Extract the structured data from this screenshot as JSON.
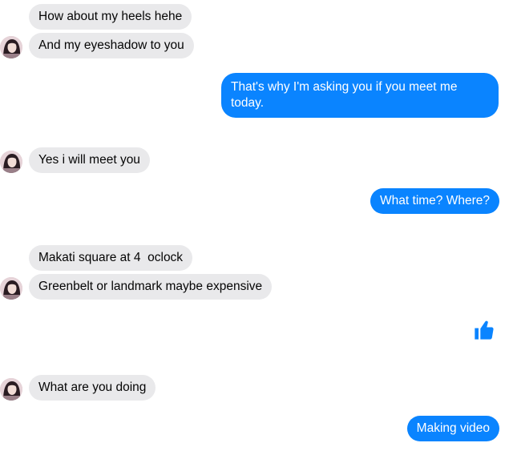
{
  "messages": [
    {
      "direction": "incoming",
      "text": "How about my heels hehe"
    },
    {
      "direction": "incoming",
      "text": "And my eyeshadow to you"
    },
    {
      "direction": "outgoing",
      "text": "That's why I'm asking you if you meet me today."
    },
    {
      "direction": "incoming",
      "text": "Yes i will meet you"
    },
    {
      "direction": "outgoing",
      "text": "What time? Where?"
    },
    {
      "direction": "incoming",
      "text": "Makati square at 4  oclock"
    },
    {
      "direction": "incoming",
      "text": "Greenbelt or landmark maybe expensive"
    },
    {
      "direction": "outgoing",
      "icon": "thumbs-up-icon"
    },
    {
      "direction": "incoming",
      "text": "What are you doing"
    },
    {
      "direction": "outgoing",
      "text": "Making video"
    }
  ],
  "colors": {
    "incoming_bubble": "#e9e9eb",
    "outgoing_bubble": "#0a84ff",
    "incoming_text": "#050505",
    "outgoing_text": "#ffffff",
    "like_icon": "#0a84ff"
  }
}
